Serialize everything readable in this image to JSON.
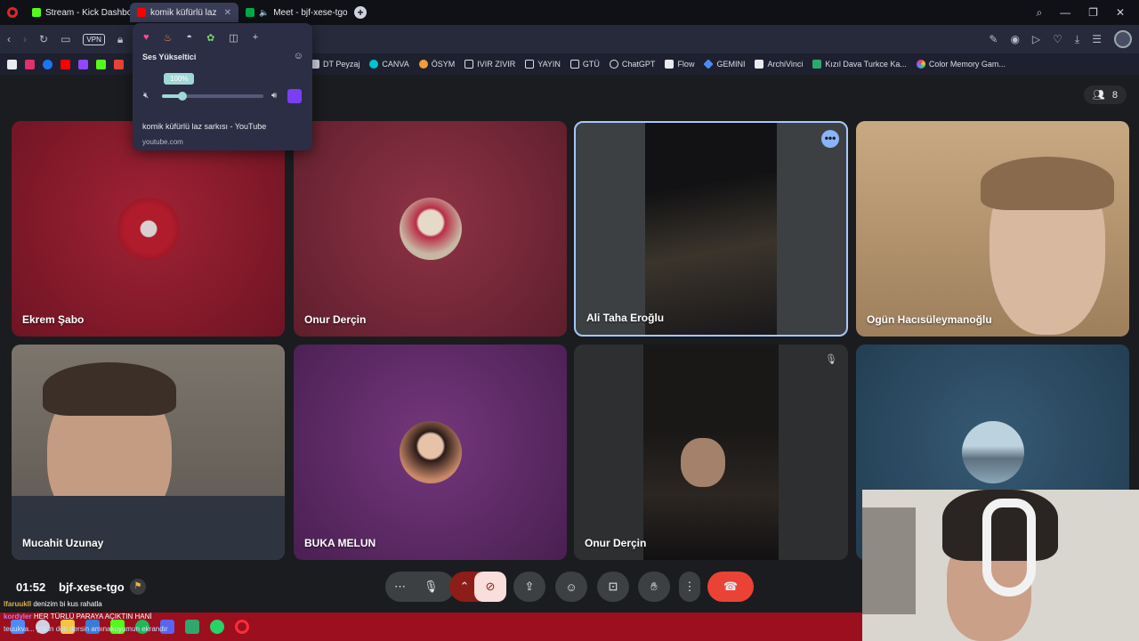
{
  "browser": {
    "tabs": [
      {
        "label": "Stream - Kick Dashboard",
        "favicon_color": "#53fc18",
        "active": false
      },
      {
        "label": "komik küfürlü laz sarkı",
        "favicon_color": "#ff0000",
        "active": true
      },
      {
        "label": "Meet - bjf-xese-tgo",
        "favicon_color": "#00ac47",
        "active": false
      }
    ],
    "bookmarks": [
      {
        "label": "DT Peyzaj",
        "color": "#cfd2de"
      },
      {
        "label": "CANVA",
        "color": "#00c4cc"
      },
      {
        "label": "ÖSYM",
        "color": "#f29e38"
      },
      {
        "label": "IVIR ZIVIR",
        "color": "#dcdfe8"
      },
      {
        "label": "YAYIN",
        "color": "#dcdfe8"
      },
      {
        "label": "GTÜ",
        "color": "#dcdfe8"
      },
      {
        "label": "ChatGPT",
        "color": "#e8eaed"
      },
      {
        "label": "Flow",
        "color": "#e8eaed"
      },
      {
        "label": "GEMINI",
        "color": "#4d8bf5"
      },
      {
        "label": "ArchiVinci",
        "color": "#e8eaed"
      },
      {
        "label": "Kızıl Dava Turkce Ka...",
        "color": "#2fa86d"
      },
      {
        "label": "Color Memory Gam...",
        "color": "#e87ec5"
      }
    ],
    "bookmark_icons": [
      "#e8eaed",
      "#e1306c",
      "#1877f2",
      "#ff0000",
      "#9146ff",
      "#53fc18",
      "#ea4335"
    ]
  },
  "meet": {
    "participant_count": "8",
    "participants": [
      {
        "name": "Ekrem Şabo",
        "bg": "#8a1a2a",
        "kind": "avatar",
        "avatar_color": "#b01c2c"
      },
      {
        "name": "Onur Derçin",
        "bg": "#7a2738",
        "kind": "avatar",
        "avatar_color": "#c7b7a3"
      },
      {
        "name": "Ali Taha Eroğlu",
        "bg": "#3c4043",
        "kind": "video",
        "active": true
      },
      {
        "name": "Ogün Hacısüleymanoğlu",
        "bg": "#b89a74",
        "kind": "video"
      },
      {
        "name": "Mucahit Uzunay",
        "bg": "#6f6961",
        "kind": "video"
      },
      {
        "name": "BUKA MELUN",
        "bg": "#5f2a66",
        "kind": "avatar",
        "avatar_color": "#c98a6a"
      },
      {
        "name": "Onur Derçin",
        "bg": "#2e2f31",
        "kind": "video",
        "muted": true
      },
      {
        "name": "",
        "bg": "#2e4a60",
        "kind": "avatar",
        "avatar_color": "#8aa7b8"
      }
    ],
    "time": "01:52",
    "meeting_code": "bjf-xese-tgo",
    "colors": {
      "hangup": "#ea4335",
      "camera_off": "#f9dedc",
      "raise_chevron": "#8c1d18",
      "active_border": "#a8c7fa"
    }
  },
  "popup": {
    "title": "Ses Yükseltici",
    "volume_label": "100%",
    "volume_fraction": 0.2,
    "page_title": "komik küfürlü laz sarkısı - YouTube",
    "url": "youtube.com"
  },
  "chat": [
    {
      "user": "lfaruukll",
      "text": "denizim bi kus rahatla"
    },
    {
      "user": "kordyler",
      "text": "HER TÜRLÜ PARAYA AÇIKTIN HANİ"
    }
  ],
  "taskbar_ticker": "teuukva... gölün dön dersin amınakoyumun ekrandır"
}
